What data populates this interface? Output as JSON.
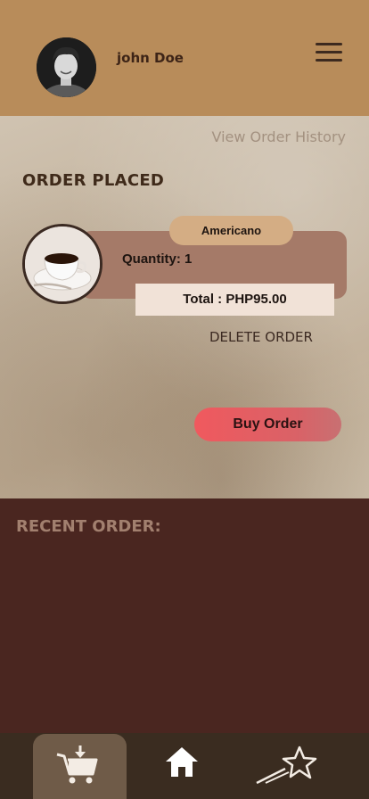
{
  "header": {
    "username": "john Doe",
    "menu_icon": "hamburger-menu-icon"
  },
  "main": {
    "view_history_label": "View Order History",
    "section_title": "ORDER PLACED",
    "order": {
      "product_name": "Americano",
      "quantity_text": "Quantity: 1",
      "total_text": "Total : PHP95.00"
    },
    "delete_label": "DELETE ORDER",
    "buy_label": "Buy Order"
  },
  "recent": {
    "title": "RECENT ORDER:"
  },
  "nav": {
    "items": [
      {
        "icon": "cart-download-icon",
        "active": true
      },
      {
        "icon": "home-icon",
        "active": false
      },
      {
        "icon": "shooting-star-icon",
        "active": false
      }
    ]
  },
  "colors": {
    "header_bg": "#b88c5a",
    "card_bg": "#a57a68",
    "pill_bg": "#d4ad84",
    "buy_button": "#f0595e",
    "recent_bg": "#4a2620",
    "nav_bg": "#3a2c20",
    "nav_active": "#6f5b48"
  }
}
